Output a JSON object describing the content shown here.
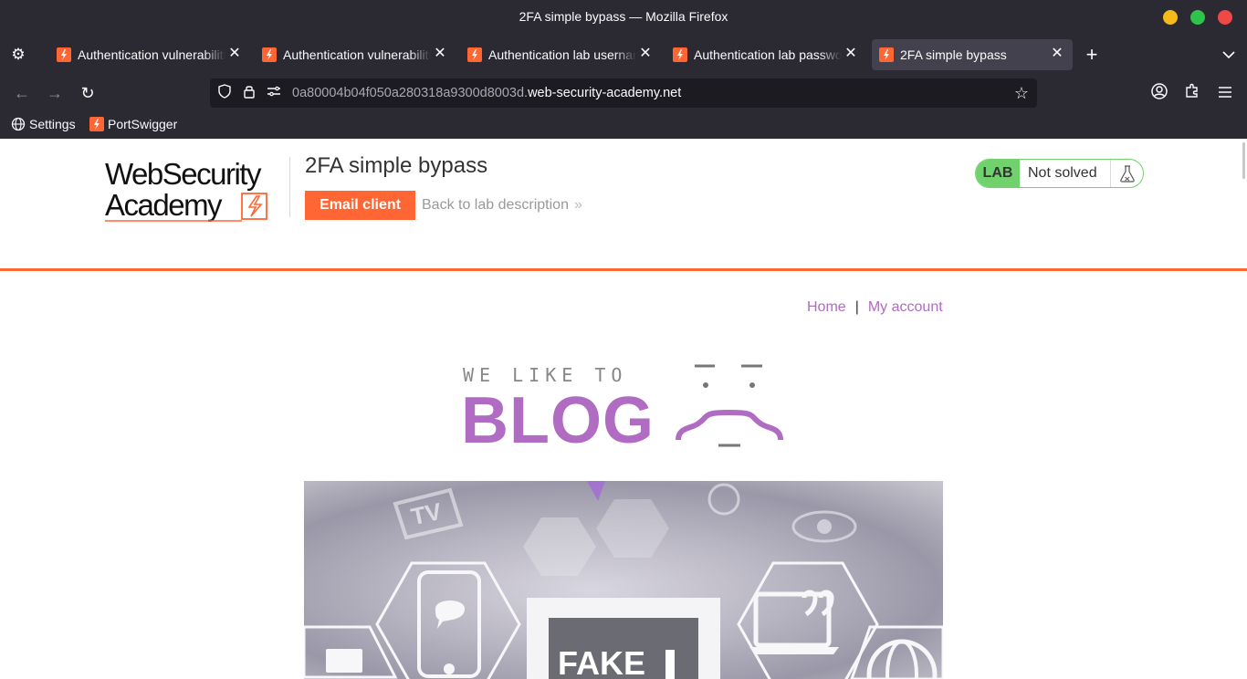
{
  "window": {
    "title": "2FA simple bypass — Mozilla Firefox"
  },
  "tabs": [
    {
      "label": "Authentication vulnerabilities",
      "active": false
    },
    {
      "label": "Authentication vulnerabilities",
      "active": false
    },
    {
      "label": "Authentication lab usernames",
      "active": false
    },
    {
      "label": "Authentication lab passwords",
      "active": false
    },
    {
      "label": "2FA simple bypass",
      "active": true
    }
  ],
  "urlbar": {
    "subdomain": "0a80004b04f050a280318a9300d8003d.",
    "domain": "web-security-academy.net"
  },
  "bookmarks": [
    {
      "label": "Settings",
      "icon": "globe-icon"
    },
    {
      "label": "PortSwigger",
      "icon": "portswigger-icon"
    }
  ],
  "header": {
    "logo_line1": "WebSecurity",
    "logo_line2": "Academy",
    "lab_title": "2FA simple bypass",
    "email_client_label": "Email client",
    "back_link_label": "Back to lab description",
    "back_link_chevron": "»",
    "lab_badge": "LAB",
    "lab_status": "Not solved"
  },
  "nav": {
    "home": "Home",
    "separator": "|",
    "my_account": "My account"
  },
  "blog_logo": {
    "small_text": "WE LIKE TO",
    "big_text": "BLOG"
  },
  "hero": {
    "fake_text": "FAKE",
    "tv_text": "TV"
  },
  "colors": {
    "accent_orange": "#ff6633",
    "link_purple": "#b06bc2",
    "lab_green": "#70d16d",
    "chrome_bg": "#2b2a33"
  }
}
